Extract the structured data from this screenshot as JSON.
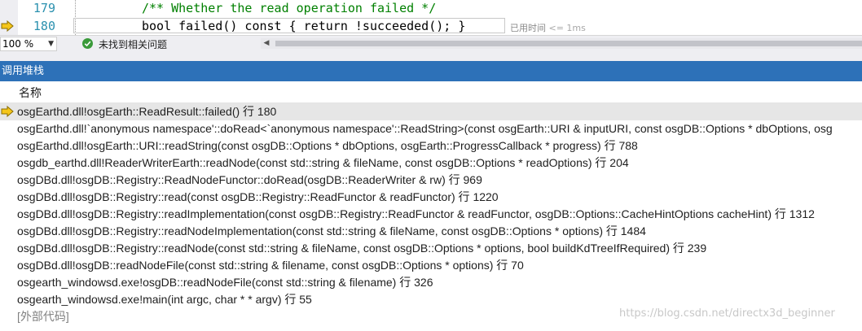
{
  "editor": {
    "lines": [
      {
        "number": "179",
        "code": "/** Whether the read operation failed */"
      },
      {
        "number": "180",
        "code": "bool failed() const { return !succeeded(); }"
      }
    ],
    "elapsed_hint": "已用时间",
    "elapsed_value": "<= 1ms"
  },
  "status": {
    "zoom": "100 %",
    "issues": "未找到相关问题"
  },
  "call_stack": {
    "title": "调用堆栈",
    "column_name": "名称",
    "rows": [
      {
        "text": "osgEarthd.dll!osgEarth::ReadResult::failed() 行 180",
        "current": true
      },
      {
        "text": "osgEarthd.dll!`anonymous namespace'::doRead<`anonymous namespace'::ReadString>(const osgEarth::URI & inputURI, const osgDB::Options * dbOptions, osg"
      },
      {
        "text": "osgEarthd.dll!osgEarth::URI::readString(const osgDB::Options * dbOptions, osgEarth::ProgressCallback * progress) 行 788"
      },
      {
        "text": "osgdb_earthd.dll!ReaderWriterEarth::readNode(const std::string & fileName, const osgDB::Options * readOptions) 行 204"
      },
      {
        "text": "osgDBd.dll!osgDB::Registry::ReadNodeFunctor::doRead(osgDB::ReaderWriter & rw) 行 969"
      },
      {
        "text": "osgDBd.dll!osgDB::Registry::read(const osgDB::Registry::ReadFunctor & readFunctor) 行 1220"
      },
      {
        "text": "osgDBd.dll!osgDB::Registry::readImplementation(const osgDB::Registry::ReadFunctor & readFunctor, osgDB::Options::CacheHintOptions cacheHint) 行 1312"
      },
      {
        "text": "osgDBd.dll!osgDB::Registry::readNodeImplementation(const std::string & fileName, const osgDB::Options * options) 行 1484"
      },
      {
        "text": "osgDBd.dll!osgDB::Registry::readNode(const std::string & fileName, const osgDB::Options * options, bool buildKdTreeIfRequired) 行 239"
      },
      {
        "text": "osgDBd.dll!osgDB::readNodeFile(const std::string & filename, const osgDB::Options * options) 行 70"
      },
      {
        "text": "osgearth_windowsd.exe!osgDB::readNodeFile(const std::string & filename) 行 326"
      },
      {
        "text": "osgearth_windowsd.exe!main(int argc, char * * argv) 行 55"
      },
      {
        "text": "[外部代码]",
        "external": true
      }
    ]
  },
  "watermark": "https://blog.csdn.net/directx3d_beginner",
  "colors": {
    "title_bar": "#2d71b8",
    "current_row": "#e6e6e6",
    "arrow": "#f5c61a",
    "ok_icon": "#3a9a3a"
  }
}
